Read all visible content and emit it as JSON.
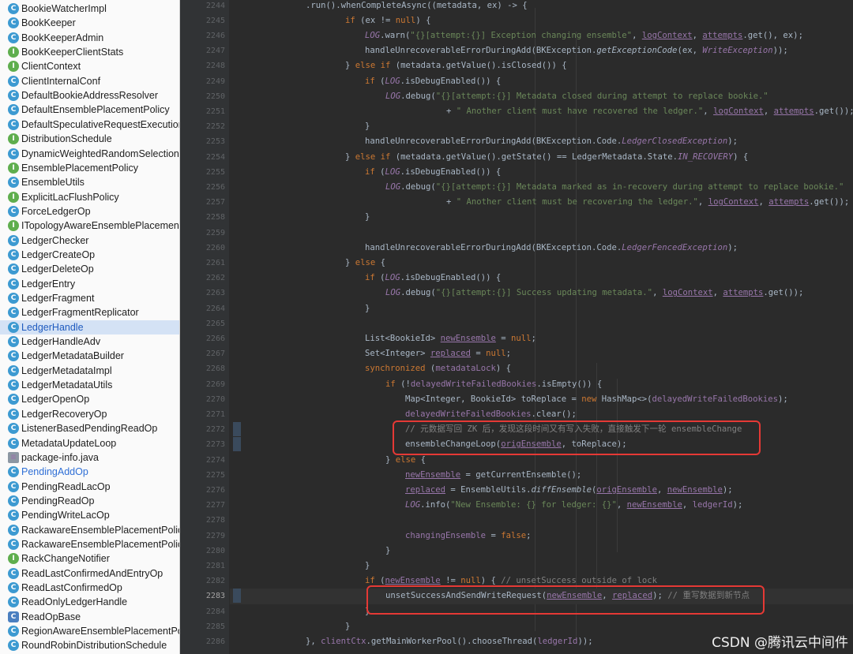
{
  "sidebar": {
    "items": [
      {
        "label": "BookieWatcherImpl",
        "icon": "class-icon"
      },
      {
        "label": "BookKeeper",
        "icon": "class-icon"
      },
      {
        "label": "BookKeeperAdmin",
        "icon": "class-icon"
      },
      {
        "label": "BookKeeperClientStats",
        "icon": "interface-icon"
      },
      {
        "label": "ClientContext",
        "icon": "interface-icon"
      },
      {
        "label": "ClientInternalConf",
        "icon": "class-icon"
      },
      {
        "label": "DefaultBookieAddressResolver",
        "icon": "class-icon"
      },
      {
        "label": "DefaultEnsemblePlacementPolicy",
        "icon": "class-icon"
      },
      {
        "label": "DefaultSpeculativeRequestExecutionPolicy",
        "icon": "class-icon"
      },
      {
        "label": "DistributionSchedule",
        "icon": "interface-icon"
      },
      {
        "label": "DynamicWeightedRandomSelectionImpl",
        "icon": "class-icon"
      },
      {
        "label": "EnsemblePlacementPolicy",
        "icon": "interface-icon"
      },
      {
        "label": "EnsembleUtils",
        "icon": "class-icon"
      },
      {
        "label": "ExplicitLacFlushPolicy",
        "icon": "interface-icon"
      },
      {
        "label": "ForceLedgerOp",
        "icon": "class-icon"
      },
      {
        "label": "ITopologyAwareEnsemblePlacementPolicy",
        "icon": "interface-icon"
      },
      {
        "label": "LedgerChecker",
        "icon": "class-icon"
      },
      {
        "label": "LedgerCreateOp",
        "icon": "class-icon"
      },
      {
        "label": "LedgerDeleteOp",
        "icon": "class-icon"
      },
      {
        "label": "LedgerEntry",
        "icon": "class-icon"
      },
      {
        "label": "LedgerFragment",
        "icon": "class-icon"
      },
      {
        "label": "LedgerFragmentReplicator",
        "icon": "class-icon"
      },
      {
        "label": "LedgerHandle",
        "icon": "class-icon",
        "selected": true
      },
      {
        "label": "LedgerHandleAdv",
        "icon": "class-icon"
      },
      {
        "label": "LedgerMetadataBuilder",
        "icon": "class-icon"
      },
      {
        "label": "LedgerMetadataImpl",
        "icon": "class-icon"
      },
      {
        "label": "LedgerMetadataUtils",
        "icon": "class-icon"
      },
      {
        "label": "LedgerOpenOp",
        "icon": "class-icon"
      },
      {
        "label": "LedgerRecoveryOp",
        "icon": "class-icon"
      },
      {
        "label": "ListenerBasedPendingReadOp",
        "icon": "class-icon"
      },
      {
        "label": "MetadataUpdateLoop",
        "icon": "class-icon"
      },
      {
        "label": "package-info.java",
        "icon": "file-icon"
      },
      {
        "label": "PendingAddOp",
        "icon": "class-icon",
        "blue": true
      },
      {
        "label": "PendingReadLacOp",
        "icon": "class-icon"
      },
      {
        "label": "PendingReadOp",
        "icon": "class-icon"
      },
      {
        "label": "PendingWriteLacOp",
        "icon": "class-icon"
      },
      {
        "label": "RackawareEnsemblePlacementPolicy",
        "icon": "class-icon"
      },
      {
        "label": "RackawareEnsemblePlacementPolicyImpl",
        "icon": "class-icon"
      },
      {
        "label": "RackChangeNotifier",
        "icon": "interface-icon"
      },
      {
        "label": "ReadLastConfirmedAndEntryOp",
        "icon": "class-icon"
      },
      {
        "label": "ReadLastConfirmedOp",
        "icon": "class-icon"
      },
      {
        "label": "ReadOnlyLedgerHandle",
        "icon": "class-icon"
      },
      {
        "label": "ReadOpBase",
        "icon": "abstract-class-icon"
      },
      {
        "label": "RegionAwareEnsemblePlacementPolicy",
        "icon": "class-icon"
      },
      {
        "label": "RoundRobinDistributionSchedule",
        "icon": "class-icon"
      }
    ]
  },
  "editor": {
    "current_line": "2283",
    "lines": [
      {
        "n": "2244",
        "indent": 3,
        "t": [
          [
            "",
            ".run().whenCompleteAsync((metadata, ex) -> {"
          ]
        ]
      },
      {
        "n": "2245",
        "indent": 4,
        "t": [
          [
            "k",
            "if "
          ],
          [
            "",
            "(ex != "
          ],
          [
            "k",
            "null"
          ],
          [
            "",
            ") {"
          ]
        ]
      },
      {
        "n": "2246",
        "indent": 5,
        "t": [
          [
            "st",
            "LOG"
          ],
          [
            "",
            ".warn("
          ],
          [
            "s",
            "\"{}[attempt:{}] Exception changing ensemble\""
          ],
          [
            "",
            ", "
          ],
          [
            "f u",
            "logContext"
          ],
          [
            "",
            ", "
          ],
          [
            "f u",
            "attempts"
          ],
          [
            "",
            ".get(), ex);"
          ]
        ]
      },
      {
        "n": "2247",
        "indent": 5,
        "t": [
          [
            "",
            "handleUnrecoverableErrorDuringAdd(BKException."
          ],
          [
            "mi",
            "getExceptionCode"
          ],
          [
            "",
            "(ex, "
          ],
          [
            "fi",
            "WriteException"
          ],
          [
            "",
            "));"
          ]
        ]
      },
      {
        "n": "2248",
        "indent": 4,
        "t": [
          [
            "",
            "} "
          ],
          [
            "k",
            "else if "
          ],
          [
            "",
            "(metadata.getValue().isClosed()) {"
          ]
        ]
      },
      {
        "n": "2249",
        "indent": 5,
        "t": [
          [
            "k",
            "if "
          ],
          [
            "",
            "("
          ],
          [
            "st",
            "LOG"
          ],
          [
            "",
            ".isDebugEnabled()) {"
          ]
        ]
      },
      {
        "n": "2250",
        "indent": 6,
        "t": [
          [
            "st",
            "LOG"
          ],
          [
            "",
            ".debug("
          ],
          [
            "s",
            "\"{}[attempt:{}] Metadata closed during attempt to replace bookie.\""
          ]
        ]
      },
      {
        "n": "2251",
        "indent": 9,
        "t": [
          [
            "",
            "+ "
          ],
          [
            "s",
            "\" Another client must have recovered the ledger.\""
          ],
          [
            "",
            ", "
          ],
          [
            "f u",
            "logContext"
          ],
          [
            "",
            ", "
          ],
          [
            "f u",
            "attempts"
          ],
          [
            "",
            ".get());"
          ]
        ]
      },
      {
        "n": "2252",
        "indent": 5,
        "t": [
          [
            "",
            "}"
          ]
        ]
      },
      {
        "n": "2253",
        "indent": 5,
        "t": [
          [
            "",
            "handleUnrecoverableErrorDuringAdd(BKException.Code."
          ],
          [
            "fi",
            "LedgerClosedException"
          ],
          [
            "",
            ");"
          ]
        ]
      },
      {
        "n": "2254",
        "indent": 4,
        "t": [
          [
            "",
            "} "
          ],
          [
            "k",
            "else if "
          ],
          [
            "",
            "(metadata.getValue().getState() == LedgerMetadata.State."
          ],
          [
            "fi",
            "IN_RECOVERY"
          ],
          [
            "",
            ") {"
          ]
        ]
      },
      {
        "n": "2255",
        "indent": 5,
        "t": [
          [
            "k",
            "if "
          ],
          [
            "",
            "("
          ],
          [
            "st",
            "LOG"
          ],
          [
            "",
            ".isDebugEnabled()) {"
          ]
        ]
      },
      {
        "n": "2256",
        "indent": 6,
        "t": [
          [
            "st",
            "LOG"
          ],
          [
            "",
            ".debug("
          ],
          [
            "s",
            "\"{}[attempt:{}] Metadata marked as in-recovery during attempt to replace bookie.\""
          ]
        ]
      },
      {
        "n": "2257",
        "indent": 9,
        "t": [
          [
            "",
            "+ "
          ],
          [
            "s",
            "\" Another client must be recovering the ledger.\""
          ],
          [
            "",
            ", "
          ],
          [
            "f u",
            "logContext"
          ],
          [
            "",
            ", "
          ],
          [
            "f u",
            "attempts"
          ],
          [
            "",
            ".get());"
          ]
        ]
      },
      {
        "n": "2258",
        "indent": 5,
        "t": [
          [
            "",
            "}"
          ]
        ]
      },
      {
        "n": "2259",
        "indent": 0,
        "t": []
      },
      {
        "n": "2260",
        "indent": 5,
        "t": [
          [
            "",
            "handleUnrecoverableErrorDuringAdd(BKException.Code."
          ],
          [
            "fi",
            "LedgerFencedException"
          ],
          [
            "",
            ");"
          ]
        ]
      },
      {
        "n": "2261",
        "indent": 4,
        "t": [
          [
            "",
            "} "
          ],
          [
            "k",
            "else "
          ],
          [
            "",
            "{"
          ]
        ]
      },
      {
        "n": "2262",
        "indent": 5,
        "t": [
          [
            "k",
            "if "
          ],
          [
            "",
            "("
          ],
          [
            "st",
            "LOG"
          ],
          [
            "",
            ".isDebugEnabled()) {"
          ]
        ]
      },
      {
        "n": "2263",
        "indent": 6,
        "t": [
          [
            "st",
            "LOG"
          ],
          [
            "",
            ".debug("
          ],
          [
            "s",
            "\"{}[attempt:{}] Success updating metadata.\""
          ],
          [
            "",
            ", "
          ],
          [
            "f u",
            "logContext"
          ],
          [
            "",
            ", "
          ],
          [
            "f u",
            "attempts"
          ],
          [
            "",
            ".get());"
          ]
        ]
      },
      {
        "n": "2264",
        "indent": 5,
        "t": [
          [
            "",
            "}"
          ]
        ]
      },
      {
        "n": "2265",
        "indent": 0,
        "t": []
      },
      {
        "n": "2266",
        "indent": 5,
        "t": [
          [
            "",
            "List<BookieId> "
          ],
          [
            "f u",
            "newEnsemble"
          ],
          [
            "",
            " = "
          ],
          [
            "k",
            "null"
          ],
          [
            "",
            ";"
          ]
        ]
      },
      {
        "n": "2267",
        "indent": 5,
        "t": [
          [
            "",
            "Set<Integer> "
          ],
          [
            "f u",
            "replaced"
          ],
          [
            "",
            " = "
          ],
          [
            "k",
            "null"
          ],
          [
            "",
            ";"
          ]
        ]
      },
      {
        "n": "2268",
        "indent": 5,
        "t": [
          [
            "k",
            "synchronized "
          ],
          [
            "",
            "("
          ],
          [
            "f",
            "metadataLock"
          ],
          [
            "",
            ") {"
          ]
        ]
      },
      {
        "n": "2269",
        "indent": 6,
        "t": [
          [
            "k",
            "if "
          ],
          [
            "",
            "(!"
          ],
          [
            "f",
            "delayedWriteFailedBookies"
          ],
          [
            "",
            ".isEmpty()) {"
          ]
        ]
      },
      {
        "n": "2270",
        "indent": 7,
        "t": [
          [
            "",
            "Map<Integer, BookieId> toReplace = "
          ],
          [
            "k",
            "new "
          ],
          [
            "",
            "HashMap<>("
          ],
          [
            "f",
            "delayedWriteFailedBookies"
          ],
          [
            "",
            ");"
          ]
        ]
      },
      {
        "n": "2271",
        "indent": 7,
        "t": [
          [
            "f",
            "delayedWriteFailedBookies"
          ],
          [
            "",
            ".clear();"
          ]
        ]
      },
      {
        "n": "2272",
        "indent": 7,
        "t": [
          [
            "cm",
            "// 元数据写回 ZK 后，发现这段时间又有写入失败，直接触发下一轮 ensembleChange"
          ]
        ]
      },
      {
        "n": "2273",
        "indent": 7,
        "t": [
          [
            "",
            "ensembleChangeLoop("
          ],
          [
            "f u",
            "origEnsemble"
          ],
          [
            "",
            ", toReplace);"
          ]
        ]
      },
      {
        "n": "2274",
        "indent": 6,
        "t": [
          [
            "",
            "} "
          ],
          [
            "k",
            "else "
          ],
          [
            "",
            "{"
          ]
        ]
      },
      {
        "n": "2275",
        "indent": 7,
        "t": [
          [
            "f u",
            "newEnsemble"
          ],
          [
            "",
            " = getCurrentEnsemble();"
          ]
        ]
      },
      {
        "n": "2276",
        "indent": 7,
        "t": [
          [
            "f u",
            "replaced"
          ],
          [
            "",
            " = EnsembleUtils."
          ],
          [
            "mi",
            "diffEnsemble"
          ],
          [
            "",
            "("
          ],
          [
            "f u",
            "origEnsemble"
          ],
          [
            "",
            ", "
          ],
          [
            "f u",
            "newEnsemble"
          ],
          [
            "",
            ");"
          ]
        ]
      },
      {
        "n": "2277",
        "indent": 7,
        "t": [
          [
            "st",
            "LOG"
          ],
          [
            "",
            ".info("
          ],
          [
            "s",
            "\"New Ensemble: {} for ledger: {}\""
          ],
          [
            "",
            ", "
          ],
          [
            "f u",
            "newEnsemble"
          ],
          [
            "",
            ", "
          ],
          [
            "f",
            "ledgerId"
          ],
          [
            "",
            ");"
          ]
        ]
      },
      {
        "n": "2278",
        "indent": 0,
        "t": []
      },
      {
        "n": "2279",
        "indent": 7,
        "t": [
          [
            "f",
            "changingEnsemble"
          ],
          [
            "",
            " = "
          ],
          [
            "k",
            "false"
          ],
          [
            "",
            ";"
          ]
        ]
      },
      {
        "n": "2280",
        "indent": 6,
        "t": [
          [
            "",
            "}"
          ]
        ]
      },
      {
        "n": "2281",
        "indent": 5,
        "t": [
          [
            "",
            "}"
          ]
        ]
      },
      {
        "n": "2282",
        "indent": 5,
        "t": [
          [
            "k",
            "if "
          ],
          [
            "",
            "("
          ],
          [
            "f u",
            "newEnsemble"
          ],
          [
            "",
            " != "
          ],
          [
            "k",
            "null"
          ],
          [
            "",
            ") { "
          ],
          [
            "cm",
            "// unsetSuccess outside of lock"
          ]
        ]
      },
      {
        "n": "2283",
        "indent": 6,
        "t": [
          [
            "",
            "unsetSuccessAndSendWriteRequest("
          ],
          [
            "f u",
            "newEnsemble"
          ],
          [
            "",
            ", "
          ],
          [
            "f u",
            "replaced"
          ],
          [
            "",
            "); "
          ],
          [
            "cm",
            "// 重写数据到新节点"
          ]
        ]
      },
      {
        "n": "2284",
        "indent": 5,
        "t": [
          [
            "",
            "}"
          ]
        ]
      },
      {
        "n": "2285",
        "indent": 4,
        "t": [
          [
            "",
            "}"
          ]
        ]
      },
      {
        "n": "2286",
        "indent": 3,
        "t": [
          [
            "",
            "}, "
          ],
          [
            "f",
            "clientCtx"
          ],
          [
            "",
            ".getMainWorkerPool().chooseThread("
          ],
          [
            "f",
            "ledgerId"
          ],
          [
            "",
            "));"
          ]
        ]
      }
    ]
  },
  "watermark": "CSDN @腾讯云中间件"
}
